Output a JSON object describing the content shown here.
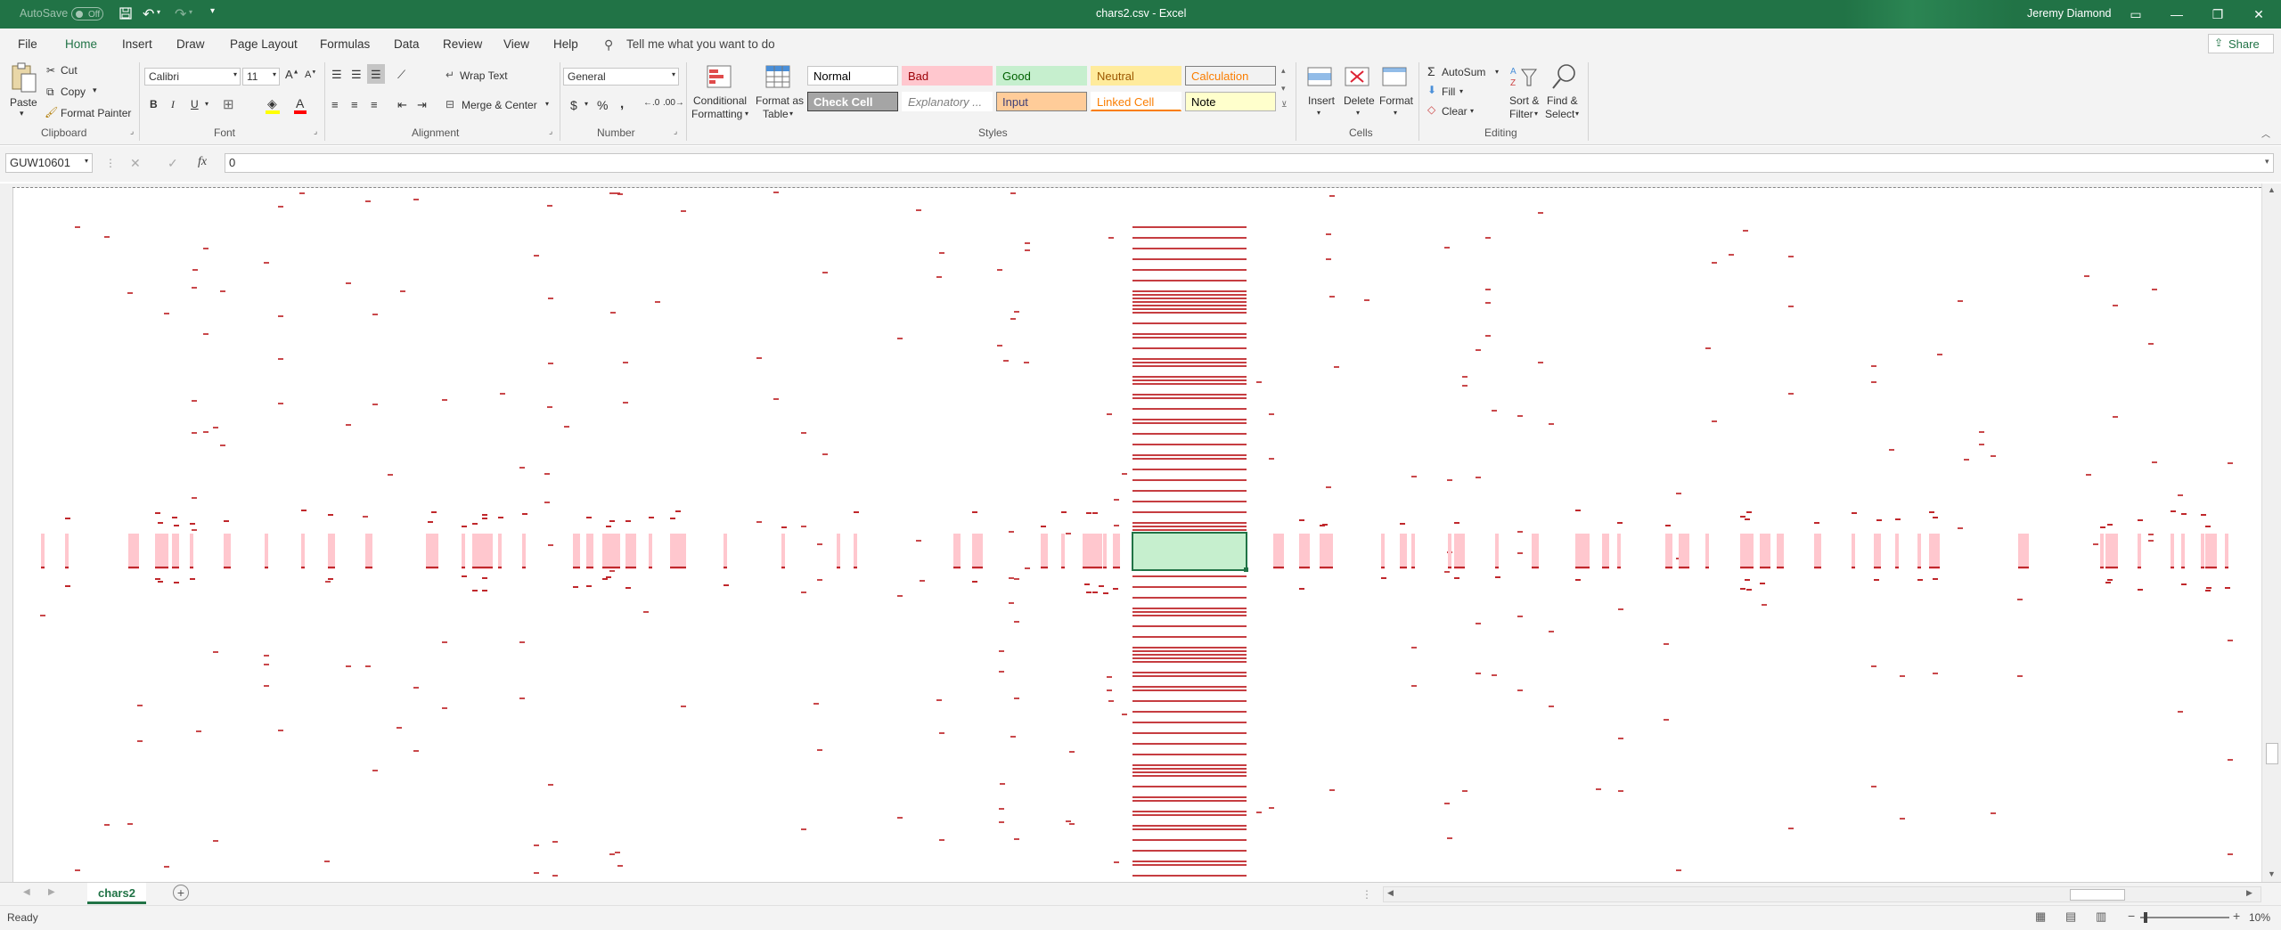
{
  "titlebar": {
    "autosave_label": "AutoSave",
    "autosave_state": "Off",
    "doc_title": "chars2.csv  -  Excel",
    "user_name": "Jeremy Diamond"
  },
  "tabs": [
    "File",
    "Home",
    "Draw",
    "Insert",
    "Page Layout",
    "Formulas",
    "Data",
    "Review",
    "View",
    "Help"
  ],
  "tell_me": "Tell me what you want to do",
  "share_label": "Share",
  "clipboard": {
    "paste": "Paste",
    "cut": "Cut",
    "copy": "Copy",
    "format_painter": "Format Painter",
    "group": "Clipboard"
  },
  "font": {
    "name": "Calibri",
    "size": "11",
    "group": "Font",
    "bold": "B",
    "italic": "I",
    "underline": "U"
  },
  "alignment": {
    "wrap_text": "Wrap Text",
    "merge_center": "Merge & Center",
    "group": "Alignment"
  },
  "number": {
    "format": "General",
    "currency": "$",
    "percent": "%",
    "comma": ",",
    "group": "Number"
  },
  "styles_group": {
    "conditional_line1": "Conditional",
    "conditional_line2": "Formatting",
    "format_table_line1": "Format as",
    "format_table_line2": "Table",
    "cells": [
      {
        "label": "Normal",
        "bg": "#ffffff",
        "fg": "#000000",
        "border": "#c6c6c6"
      },
      {
        "label": "Bad",
        "bg": "#ffc7ce",
        "fg": "#9c0006",
        "border": "#ffc7ce"
      },
      {
        "label": "Good",
        "bg": "#c6efce",
        "fg": "#006100",
        "border": "#c6efce"
      },
      {
        "label": "Neutral",
        "bg": "#ffeb9c",
        "fg": "#9c5700",
        "border": "#ffeb9c"
      },
      {
        "label": "Calculation",
        "bg": "#f2f2f2",
        "fg": "#fa7d00",
        "border": "#7f7f7f"
      },
      {
        "label": "Check Cell",
        "bg": "#a5a5a5",
        "fg": "#ffffff",
        "border": "#3f3f3f"
      },
      {
        "label": "Explanatory ...",
        "bg": "#ffffff",
        "fg": "#7f7f7f",
        "border": "#ffffff"
      },
      {
        "label": "Input",
        "bg": "#ffcc99",
        "fg": "#3f3f76",
        "border": "#7f7f7f"
      },
      {
        "label": "Linked Cell",
        "bg": "#ffffff",
        "fg": "#fa7d00",
        "border": "#ffffff"
      },
      {
        "label": "Note",
        "bg": "#ffffcc",
        "fg": "#000000",
        "border": "#b2b2b2"
      }
    ],
    "group": "Styles"
  },
  "cells_group": {
    "insert": "Insert",
    "delete": "Delete",
    "format": "Format",
    "group": "Cells"
  },
  "editing": {
    "autosum": "AutoSum",
    "fill": "Fill",
    "clear": "Clear",
    "sort_line1": "Sort &",
    "sort_line2": "Filter",
    "find_line1": "Find &",
    "find_line2": "Select",
    "group": "Editing"
  },
  "formula_bar": {
    "name_box": "GUW10601",
    "value": "0"
  },
  "sheet_tab": "chars2",
  "status": {
    "left": "Ready",
    "zoom": "10%"
  },
  "colors": {
    "accent": "#217346",
    "cell_highlight": "#ffc7ce",
    "cell_text": "#c0282c",
    "selection_fill": "#c6efce"
  },
  "icons": [
    "save-icon",
    "undo-icon",
    "redo-icon",
    "search-icon",
    "share-icon",
    "paste-icon",
    "cut-icon",
    "copy-icon",
    "format-painter-icon",
    "sort-filter-icon",
    "find-select-icon",
    "autosum-icon",
    "insert-cells-icon",
    "delete-cells-icon",
    "format-cells-icon",
    "new-sheet-icon"
  ]
}
